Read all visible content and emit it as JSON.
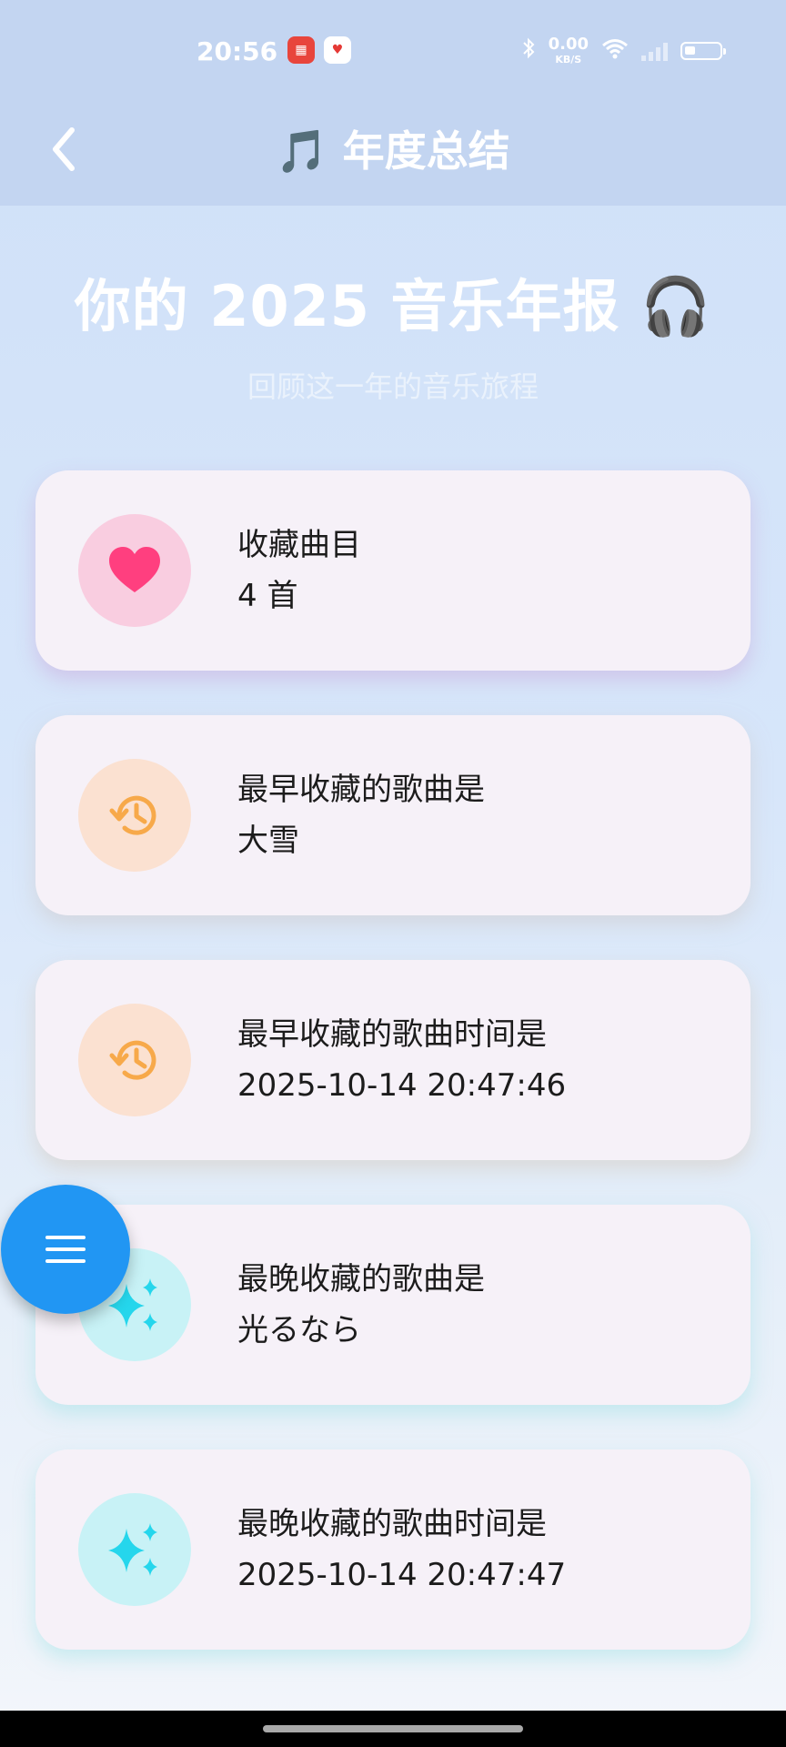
{
  "status_bar": {
    "time": "20:56",
    "app_icons": [
      "news-app-icon",
      "heart-app-icon"
    ],
    "net_speed_value": "0.00",
    "net_speed_unit": "KB/S",
    "battery_level": 0.3
  },
  "app_bar": {
    "back_icon": "chevron-left-icon",
    "title": "🎵 年度总结"
  },
  "hero": {
    "title": "你的 2025 音乐年报 🎧",
    "subtitle": "回顾这一年的音乐旅程"
  },
  "cards": [
    {
      "icon": "heart-icon",
      "icon_color": "#ff3f7f",
      "bg_color": "#f9cde0",
      "label": "收藏曲目",
      "value": "4 首"
    },
    {
      "icon": "history-icon",
      "icon_color": "#f7a94a",
      "bg_color": "#fbe1d1",
      "label": "最早收藏的歌曲是",
      "value": "大雪"
    },
    {
      "icon": "history-icon",
      "icon_color": "#f7a94a",
      "bg_color": "#fbe1d1",
      "label": "最早收藏的歌曲时间是",
      "value": "2025-10-14 20:47:46"
    },
    {
      "icon": "sparkle-icon",
      "icon_color": "#25d6ec",
      "bg_color": "#c8f2f6",
      "label": "最晚收藏的歌曲是",
      "value": "光るなら"
    },
    {
      "icon": "sparkle-icon",
      "icon_color": "#25d6ec",
      "bg_color": "#c8f2f6",
      "label": "最晚收藏的歌曲时间是",
      "value": "2025-10-14 20:47:47"
    }
  ],
  "fab": {
    "icon": "menu-icon"
  }
}
